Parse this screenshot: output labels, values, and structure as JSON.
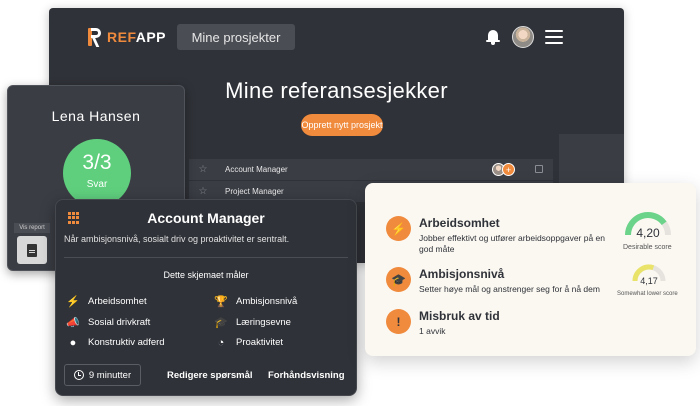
{
  "app": {
    "logo_text_prefix": "",
    "logo_text_ref": "REF",
    "logo_text_app": "APP",
    "nav_pill": "Mine prosjekter",
    "page_title": "Mine referansesjekker",
    "create_button": "Opprett nytt prosjekt",
    "projects": [
      {
        "name": "Account Manager"
      },
      {
        "name": "Project Manager"
      }
    ],
    "plus_symbol": "+"
  },
  "candidate": {
    "name": "Lena  Hansen",
    "score": "3/3",
    "score_label": "Svar",
    "vis_report": "Vis report"
  },
  "role_card": {
    "title": "Account Manager",
    "subtitle": "Når ambisjonsnivå, sosialt driv og proaktivitet er sentralt.",
    "measures_heading": "Dette skjemaet måler",
    "traits_left": [
      "Arbeidsomhet",
      "Sosial drivkraft",
      "Konstruktiv adferd"
    ],
    "traits_right": [
      "Ambisjonsnivå",
      "Læringsevne",
      "Proaktivitet"
    ],
    "duration": "9 minutter",
    "edit_questions": "Redigere spørsmål",
    "preview": "Forhåndsvisning"
  },
  "results": {
    "items": [
      {
        "title": "Arbeidsomhet",
        "desc": "Jobber effektivt og utfører arbeidsoppgaver på en god måte",
        "icon": "lightning-icon"
      },
      {
        "title": "Ambisjonsnivå",
        "desc": "Setter høye mål og anstrenger seg for å nå dem",
        "icon": "graduation-cap-icon"
      },
      {
        "title": "Misbruk av tid",
        "desc": "1 avvik",
        "icon": "exclamation-icon"
      }
    ],
    "gauges": [
      {
        "value": "4,20",
        "label": "Desirable score",
        "fill": 0.8,
        "color": "#6cd48a"
      },
      {
        "value": "4,17",
        "label": "Somewhat lower score",
        "fill": 0.6,
        "color": "#e9e36a"
      }
    ]
  },
  "colors": {
    "accent": "#f08a3c",
    "success": "#5fcf7d",
    "dark": "#2f3238"
  }
}
